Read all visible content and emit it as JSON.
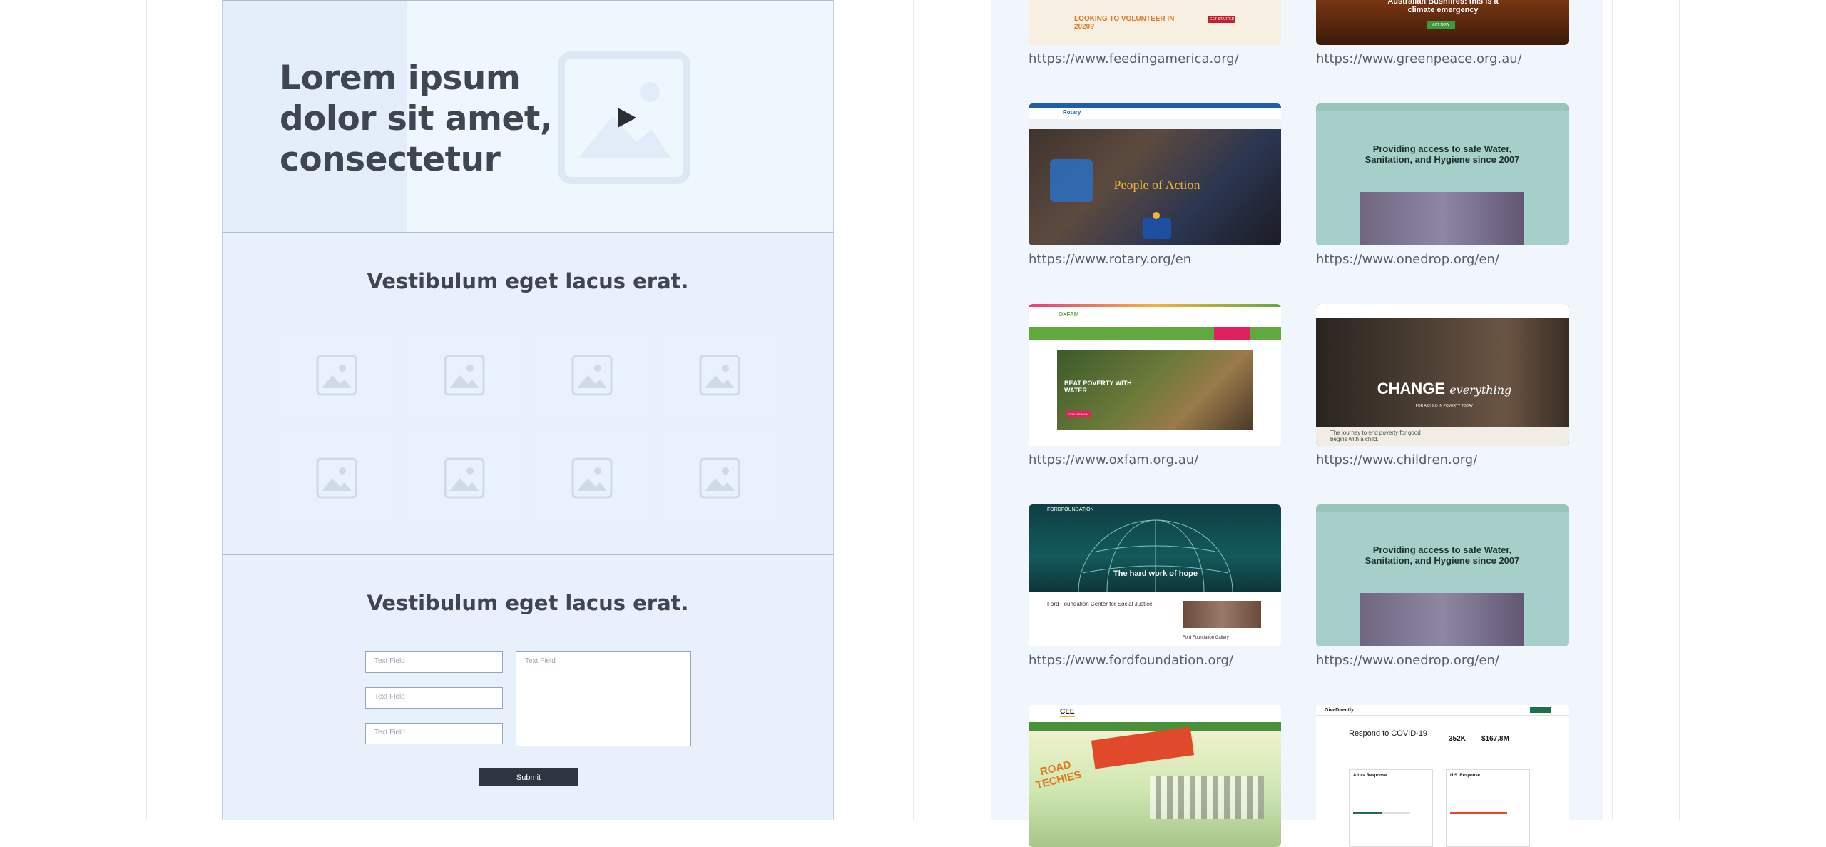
{
  "hero": {
    "title": "Lorem ipsum dolor sit amet, consectetur",
    "media_icon": "play-icon"
  },
  "gallery": {
    "title": "Vestibulum eget lacus erat.",
    "tile_icon": "image-placeholder-icon",
    "tile_count": 8
  },
  "contact_form": {
    "title": "Vestibulum eget lacus erat.",
    "fields": [
      {
        "placeholder": "Text Field"
      },
      {
        "placeholder": "Text Field"
      },
      {
        "placeholder": "Text Field"
      }
    ],
    "textarea_placeholder": "Text Field",
    "submit_label": "Submit"
  },
  "thumbnails": {
    "feedingamerica": {
      "url": "https://www.feedingamerica.org/",
      "heading": "LOOKING TO VOLUNTEER IN 2020?",
      "cta": "GET STARTED"
    },
    "greenpeace": {
      "url": "https://www.greenpeace.org.au/",
      "heading": "Australian Bushfires: this is a climate emergency",
      "cta": "ACT NOW"
    },
    "rotary": {
      "url": "https://www.rotary.org/en",
      "logo": "Rotary",
      "heading": "People of Action"
    },
    "onedrop_1": {
      "url": "https://www.onedrop.org/en/",
      "heading": "Providing access to safe Water, Sanitation, and Hygiene since 2007"
    },
    "oxfam": {
      "url": "https://www.oxfam.org.au/",
      "logo": "OXFAM",
      "heading": "BEAT POVERTY WITH WATER",
      "cta": "DONATE NOW"
    },
    "children": {
      "url": "https://www.children.org/",
      "heading_a": "CHANGE",
      "heading_b": "everything",
      "sub": "FOR A CHILD IN POVERTY TODAY",
      "footer": "The journey to end poverty for good begins with a child."
    },
    "fordfoundation": {
      "url": "https://www.fordfoundation.org/",
      "logo": "FORDFOUNDATION",
      "heading": "The hard work of hope",
      "sub": "Ford Foundation Center for Social Justice",
      "caption": "Ford Foundation Gallery"
    },
    "onedrop_2": {
      "url": "https://www.onedrop.org/en/",
      "heading": "Providing access to safe Water, Sanitation, and Hygiene since 2007"
    },
    "cee": {
      "logo": "CEE",
      "heading": "ROAD TECHIES"
    },
    "givedirectly": {
      "logo": "GiveDirectly",
      "heading": "Respond to COVID-19",
      "stat_a": "352K",
      "stat_b": "$167.8M",
      "col_a": "Africa Response",
      "col_b": "U.S. Response"
    }
  },
  "colors": {
    "panel_bg": "#e8f1fb",
    "title_text": "#3f4651",
    "submit_bg": "#2d3641",
    "onedrop_teal": "#a5cfc8",
    "oxfam_green": "#61a83f"
  }
}
